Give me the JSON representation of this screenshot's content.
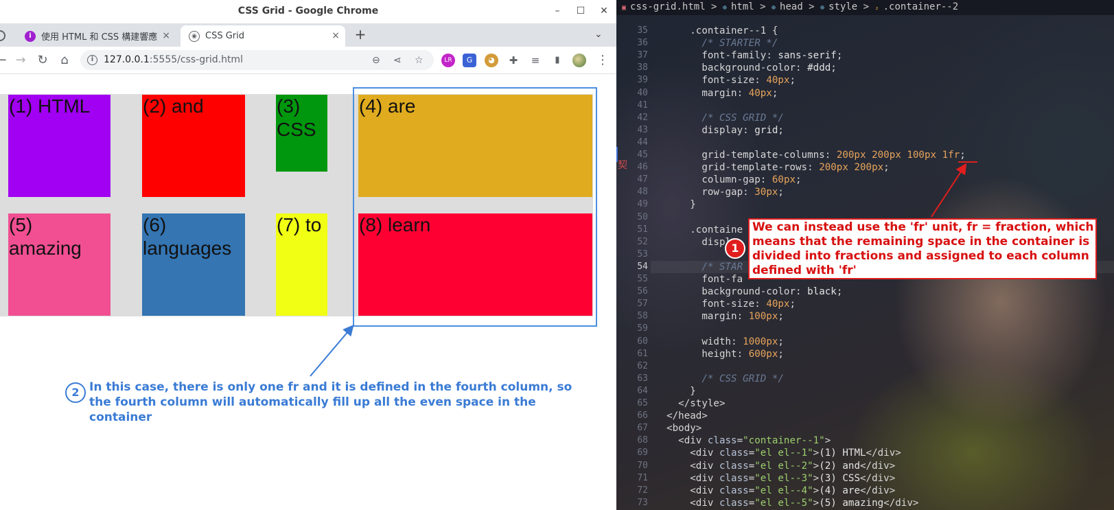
{
  "window": {
    "title": "CSS Grid - Google Chrome",
    "controls": [
      "–",
      "☐",
      "✕"
    ]
  },
  "tabs": [
    {
      "label": "使用 HTML 和 CSS 構建響應",
      "icon": "purple-site-icon",
      "close": "×"
    },
    {
      "label": "CSS Grid",
      "icon": "broadcast-icon",
      "close": "×",
      "active": true
    }
  ],
  "tabstrip": {
    "new_tab": "+",
    "tab_menu": "⌄"
  },
  "toolbar": {
    "back": "←",
    "forward": "→",
    "reload": "↻",
    "home": "⌂",
    "url_host": "127.0.0.1",
    "url_rest": ":5555/css-grid.html",
    "zoom": "⊖",
    "share": "⋖",
    "bookmark": "☆",
    "extensions": [
      {
        "name": "lr-extension-icon",
        "label": "LR",
        "color": "#c225c8"
      },
      {
        "name": "translate-extension-icon",
        "label": "G",
        "color": "#3b63d6"
      },
      {
        "name": "cookie-extension-icon",
        "label": "◕",
        "color": "#d39b3a"
      },
      {
        "name": "puzzle-extension-icon",
        "label": "✚",
        "color": "#5f6368"
      },
      {
        "name": "media-icon",
        "label": "≡",
        "color": "#5f6368"
      },
      {
        "name": "sidepanel-icon",
        "label": "▮",
        "color": "#5f6368"
      }
    ],
    "menu": "⋮"
  },
  "grid": {
    "background": "#dddddd",
    "cells": [
      {
        "label": "(1) HTML",
        "color": "#a100f2"
      },
      {
        "label": "(2) and",
        "color": "#ff0000"
      },
      {
        "label": "(3) CSS",
        "color": "#00970e"
      },
      {
        "label": "(4) are",
        "color": "#e0ab1e"
      },
      {
        "label": "(5) amazing",
        "color": "#f14f92"
      },
      {
        "label": "(6) languages",
        "color": "#3475b2"
      },
      {
        "label": "(7) to",
        "color": "#f1ff15"
      },
      {
        "label": "(8) learn",
        "color": "#ff0033"
      }
    ]
  },
  "annotations": {
    "note1_number": "1",
    "note1_text": "We can instead use the 'fr' unit, fr = fraction, which means that the remaining space in the container is divided into fractions and assigned to each column defined with 'fr'",
    "note2_number": "2",
    "note2_text": "In this case, there is only one fr and it is defined in the fourth column, so the fourth column will automatically fill up all the even space in the container",
    "accent_red": "#e01e1e",
    "accent_blue": "#3a7bd5"
  },
  "editor": {
    "breadcrumb": [
      "css-grid.html",
      "html",
      "head",
      "style",
      ".container--2"
    ],
    "lines": [
      {
        "n": "35",
        "code": "      .container--1 {"
      },
      {
        "n": "36",
        "code": "        /* STARTER */"
      },
      {
        "n": "37",
        "code": "        font-family: sans-serif;"
      },
      {
        "n": "38",
        "code": "        background-color: #ddd;"
      },
      {
        "n": "39",
        "code": "        font-size: 40px;"
      },
      {
        "n": "40",
        "code": "        margin: 40px;"
      },
      {
        "n": "41",
        "code": ""
      },
      {
        "n": "42",
        "code": "        /* CSS GRID */"
      },
      {
        "n": "43",
        "code": "        display: grid;"
      },
      {
        "n": "44",
        "code": ""
      },
      {
        "n": "45",
        "code": "        grid-template-columns: 200px 200px 100px 1fr;"
      },
      {
        "n": "46",
        "code": "        grid-template-rows: 200px 200px;"
      },
      {
        "n": "47",
        "code": "        column-gap: 60px;"
      },
      {
        "n": "48",
        "code": "        row-gap: 30px;"
      },
      {
        "n": "49",
        "code": "      }"
      },
      {
        "n": "50",
        "code": ""
      },
      {
        "n": "51",
        "code": "      .containe"
      },
      {
        "n": "52",
        "code": "        displ"
      },
      {
        "n": "53",
        "code": ""
      },
      {
        "n": "54",
        "code": "        /* STAR"
      },
      {
        "n": "55",
        "code": "        font-fa"
      },
      {
        "n": "56",
        "code": "        background-color: black;"
      },
      {
        "n": "57",
        "code": "        font-size: 40px;"
      },
      {
        "n": "58",
        "code": "        margin: 100px;"
      },
      {
        "n": "59",
        "code": ""
      },
      {
        "n": "60",
        "code": "        width: 1000px;"
      },
      {
        "n": "61",
        "code": "        height: 600px;"
      },
      {
        "n": "62",
        "code": ""
      },
      {
        "n": "63",
        "code": "        /* CSS GRID */"
      },
      {
        "n": "64",
        "code": "      }"
      },
      {
        "n": "65",
        "code": "    </style>"
      },
      {
        "n": "66",
        "code": "  </head>"
      },
      {
        "n": "67",
        "code": "  <body>"
      },
      {
        "n": "68",
        "code": "    <div class=\"container--1\">"
      },
      {
        "n": "69",
        "code": "      <div class=\"el el--1\">(1) HTML</div>"
      },
      {
        "n": "70",
        "code": "      <div class=\"el el--2\">(2) and</div>"
      },
      {
        "n": "71",
        "code": "      <div class=\"el el--3\">(3) CSS</div>"
      },
      {
        "n": "72",
        "code": "      <div class=\"el el--4\">(4) are</div>"
      },
      {
        "n": "73",
        "code": "      <div class=\"el el--5\">(5) amazing</div>"
      }
    ],
    "gutter_char": "契"
  }
}
